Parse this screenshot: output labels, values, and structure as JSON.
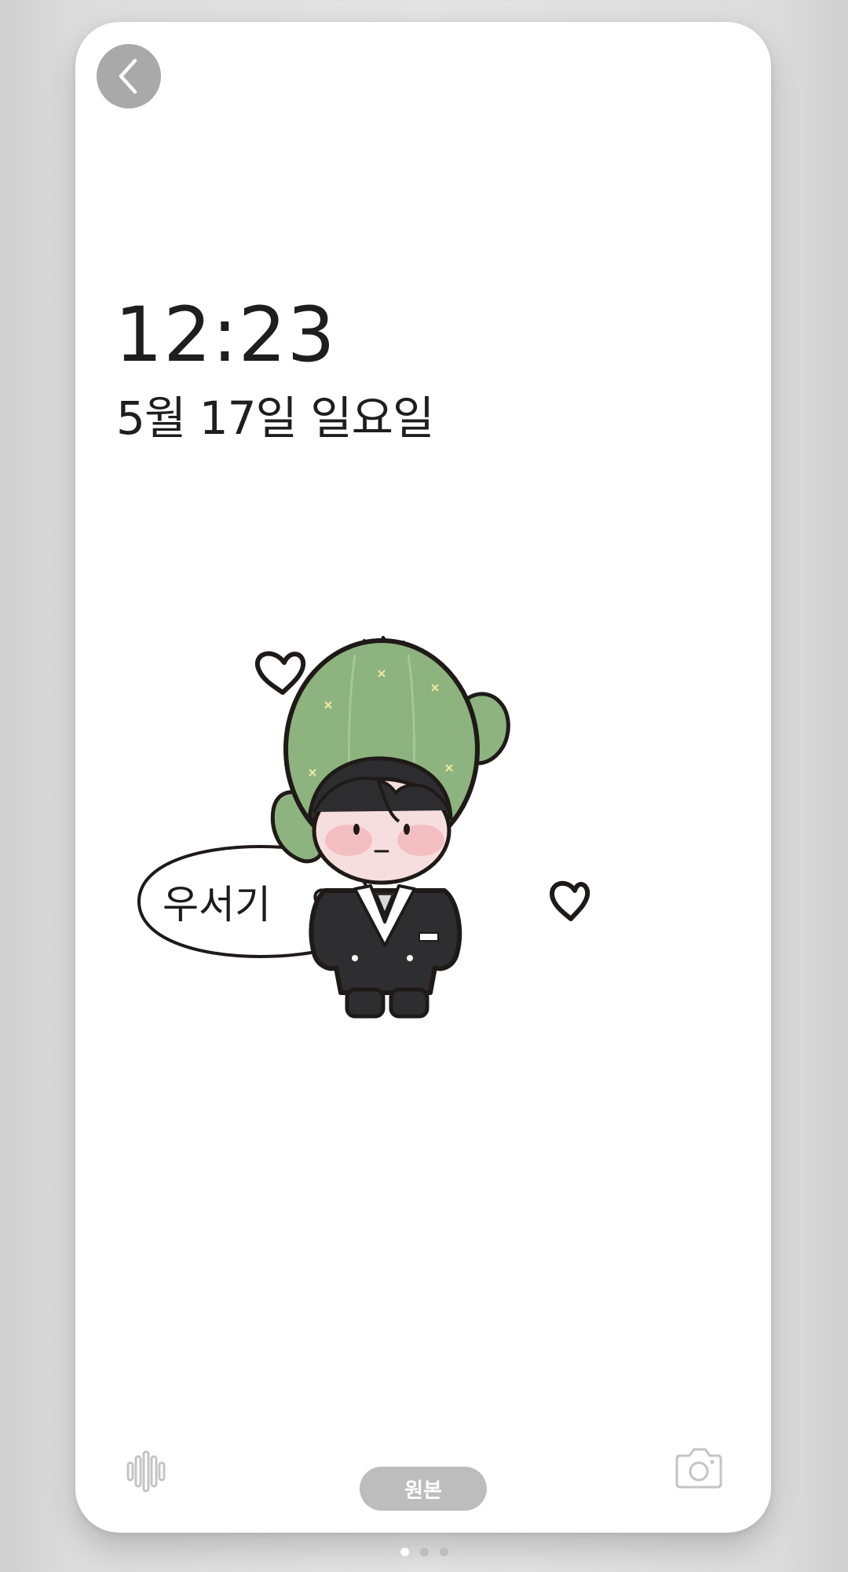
{
  "lockscreen": {
    "time": "12:23",
    "date": "5월 17일 일요일"
  },
  "illustration": {
    "speech_bubble_text": "우서기"
  },
  "controls": {
    "back_icon": "chevron-left-icon",
    "voice_icon": "voice-waveform-icon",
    "original_button_label": "원본",
    "camera_icon": "camera-icon"
  },
  "pagination": {
    "total": 3,
    "current": 1
  },
  "colors": {
    "cactus_green": "#8db37f",
    "suit_black": "#2e2e30",
    "outline": "#1f1a17",
    "button_gray": "#bdbdbd",
    "crown_yellow": "#e9c65a"
  }
}
